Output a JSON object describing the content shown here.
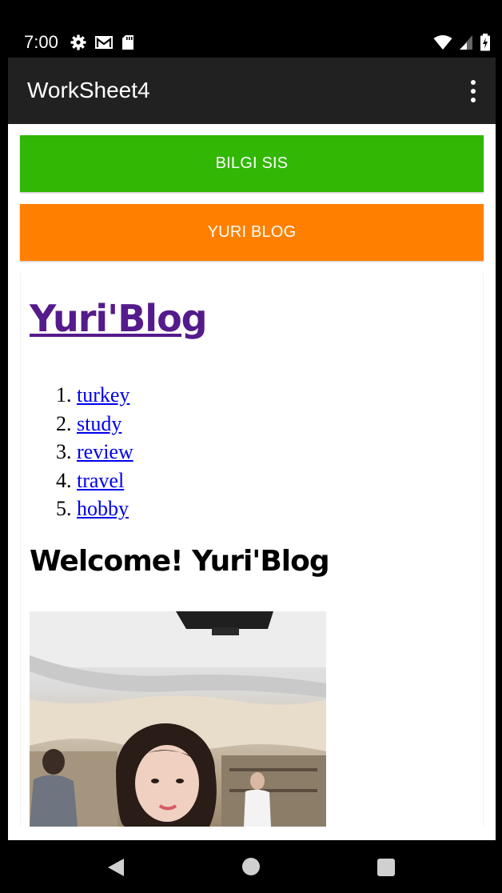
{
  "status_bar": {
    "time": "7:00",
    "left_icons": [
      "gear-icon",
      "gmail-icon",
      "sd-card-icon"
    ],
    "right_icons": [
      "wifi-icon",
      "cell-signal-icon",
      "battery-charging-icon"
    ]
  },
  "app_bar": {
    "title": "WorkSheet4",
    "overflow_icon": "more-vert-icon"
  },
  "buttons": {
    "bilgi_sis": "BILGI SIS",
    "yuri_blog": "YURI BLOG"
  },
  "colors": {
    "bilgi_button": "#31b704",
    "yuri_button": "#ff8000",
    "app_bar": "#212121",
    "visited_link": "#551a8b",
    "link": "#0000ee"
  },
  "webview": {
    "title": "Yuri'Blog",
    "menu": [
      {
        "num": "1.",
        "label": "turkey"
      },
      {
        "num": "2.",
        "label": "study"
      },
      {
        "num": "3.",
        "label": "review"
      },
      {
        "num": "4.",
        "label": "travel"
      },
      {
        "num": "5.",
        "label": "hobby"
      }
    ],
    "welcome": "Welcome! Yuri'Blog"
  },
  "nav_bar": {
    "back": "back-icon",
    "home": "home-icon",
    "recents": "recents-icon"
  }
}
